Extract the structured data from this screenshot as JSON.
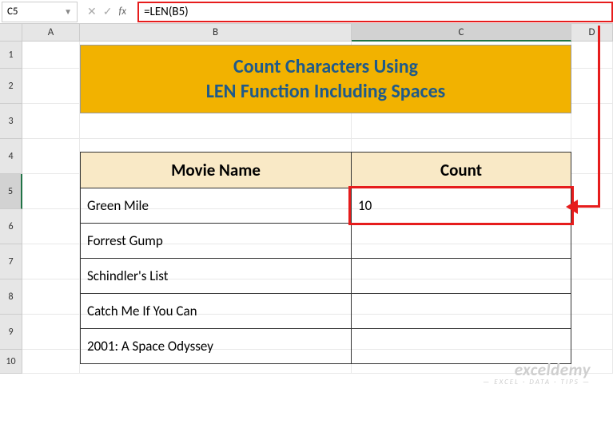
{
  "nameBox": {
    "value": "C5"
  },
  "formulaBar": {
    "formula": "=LEN(B5)"
  },
  "columns": {
    "A": "A",
    "B": "B",
    "C": "C",
    "D": "D"
  },
  "rowNumbers": [
    "1",
    "2",
    "3",
    "4",
    "5",
    "6",
    "7",
    "8",
    "9",
    "10"
  ],
  "title": {
    "line1": "Count Characters Using",
    "line2": "LEN Function Including Spaces"
  },
  "table": {
    "headers": {
      "col1": "Movie Name",
      "col2": "Count"
    },
    "rows": [
      {
        "name": "Green Mile",
        "count": "10"
      },
      {
        "name": "Forrest Gump",
        "count": ""
      },
      {
        "name": "Schindler's List",
        "count": ""
      },
      {
        "name": "Catch  Me If You Can",
        "count": ""
      },
      {
        "name": "2001: A Space Odyssey",
        "count": ""
      }
    ]
  },
  "chart_data": {
    "type": "table",
    "title": "Count Characters Using LEN Function Including Spaces",
    "columns": [
      "Movie Name",
      "Count"
    ],
    "rows": [
      [
        "Green Mile",
        10
      ],
      [
        "Forrest Gump",
        null
      ],
      [
        "Schindler's List",
        null
      ],
      [
        "Catch  Me If You Can",
        null
      ],
      [
        "2001: A Space Odyssey",
        null
      ]
    ]
  },
  "watermark": {
    "line1": "exceldemy",
    "line2": "— EXCEL · DATA · TIPS —"
  }
}
